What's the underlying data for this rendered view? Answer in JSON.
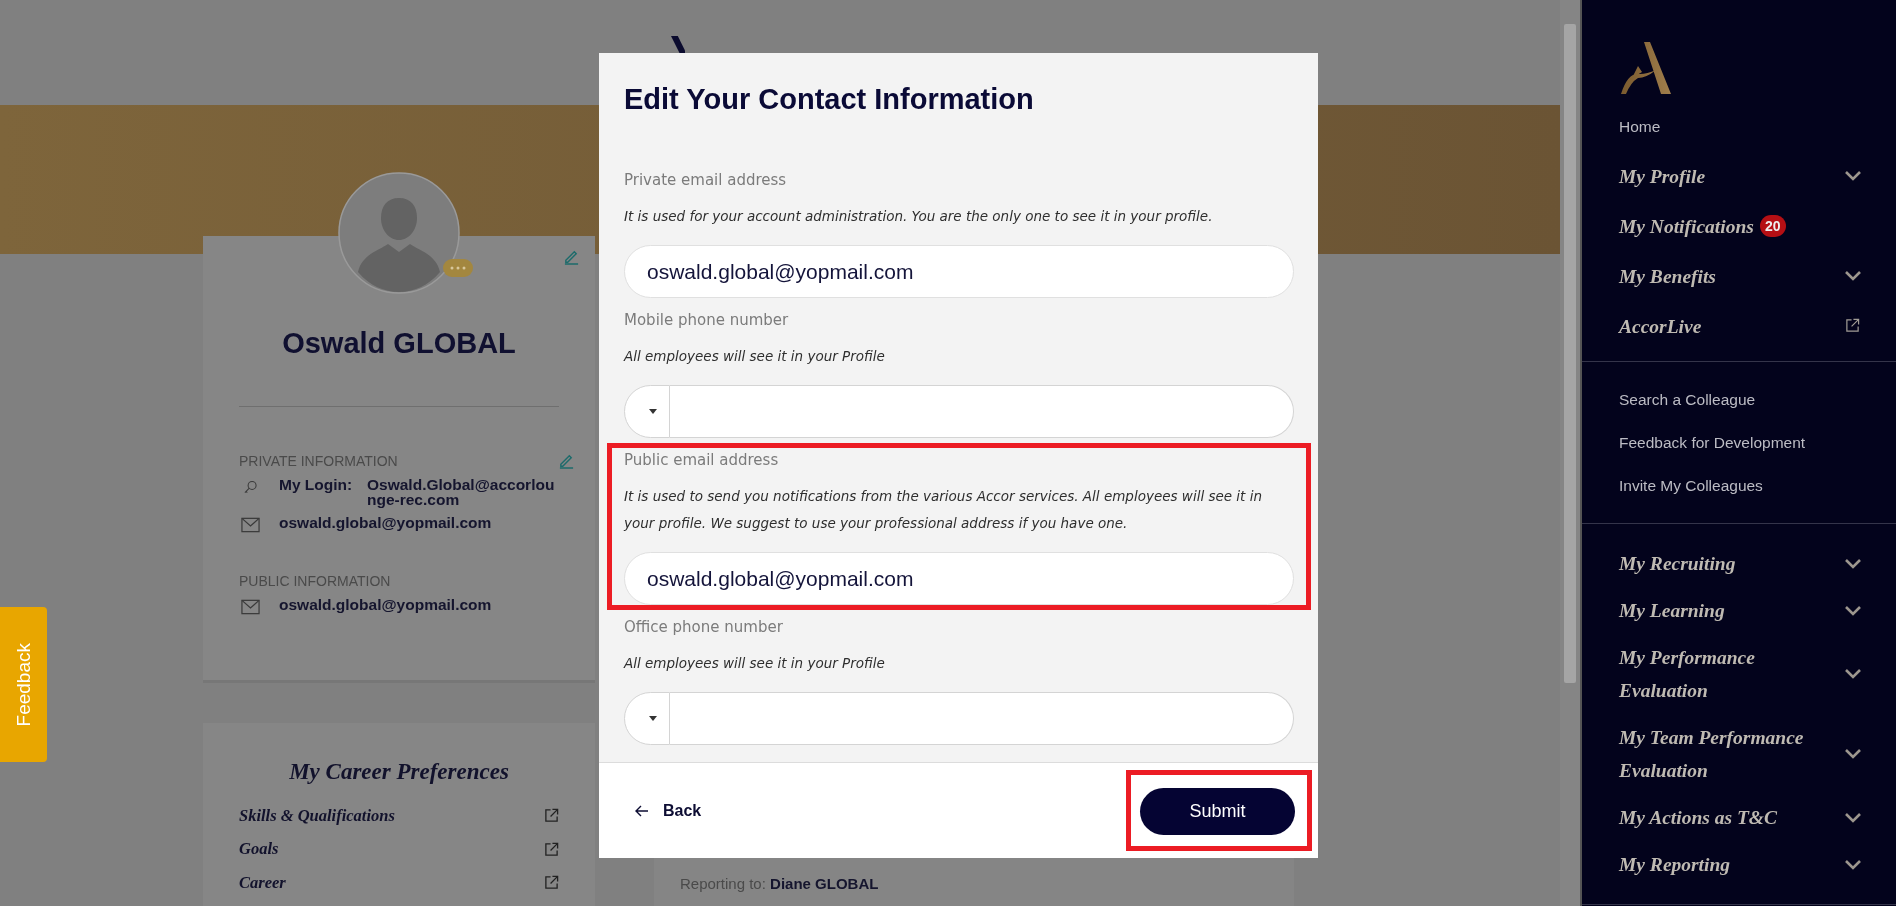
{
  "profile": {
    "name": "Oswald GLOBAL",
    "private_heading": "PRIVATE INFORMATION",
    "login_label": "My Login:",
    "login_value": "Oswald.Global@accorlounge-rec.com",
    "private_email": "oswald.global@yopmail.com",
    "public_heading": "PUBLIC INFORMATION",
    "public_email": "oswald.global@yopmail.com"
  },
  "career": {
    "title": "My Career Preferences",
    "items": [
      "Skills & Qualifications",
      "Goals",
      "Career"
    ]
  },
  "reporting": "Reporting to: **Diane GLOBAL**",
  "feedback_tab": "Feedback",
  "modal": {
    "title": "Edit Your Contact Information",
    "fields": [
      {
        "kind": "email",
        "label": "Private email address",
        "hint": "It is used for your account administration. You are the only one to see it in your profile.",
        "value": "oswald.global@yopmail.com",
        "highlighted": false
      },
      {
        "kind": "phone",
        "label": "Mobile phone number",
        "hint": "All employees will see it in your Profile",
        "highlighted": false
      },
      {
        "kind": "email",
        "label": "Public email address",
        "hint": "It is used to send you notifications from the various Accor services. All employees will see it in your profile. We suggest to use your professional address if you have one.",
        "value": "oswald.global@yopmail.com",
        "highlighted": true
      },
      {
        "kind": "phone",
        "label": "Office phone number",
        "hint": "All employees will see it in your Profile",
        "highlighted": false
      }
    ],
    "back": "Back",
    "submit": "Submit",
    "submit_highlighted": true
  },
  "sidebar": {
    "groups": [
      {
        "items": [
          {
            "kind": "plain",
            "label": "Home"
          },
          {
            "kind": "expandable",
            "label": "My Profile"
          },
          {
            "kind": "section",
            "label": "My Notifications",
            "badge": "20"
          },
          {
            "kind": "expandable",
            "label": "My Benefits"
          },
          {
            "kind": "external",
            "label": "AccorLive"
          }
        ]
      },
      {
        "items": [
          {
            "kind": "plain",
            "label": "Search a Colleague"
          },
          {
            "kind": "plain",
            "label": "Feedback for Development"
          },
          {
            "kind": "plain",
            "label": "Invite My Colleagues"
          }
        ]
      },
      {
        "items": [
          {
            "kind": "expandable",
            "label": "My Recruiting"
          },
          {
            "kind": "expandable",
            "label": "My Learning"
          },
          {
            "kind": "expandable",
            "label": "My Performance Evaluation"
          },
          {
            "kind": "expandable",
            "label": "My Team Performance Evaluation"
          },
          {
            "kind": "expandable",
            "label": "My Actions as T&C"
          },
          {
            "kind": "expandable",
            "label": "My Reporting"
          }
        ]
      }
    ]
  }
}
